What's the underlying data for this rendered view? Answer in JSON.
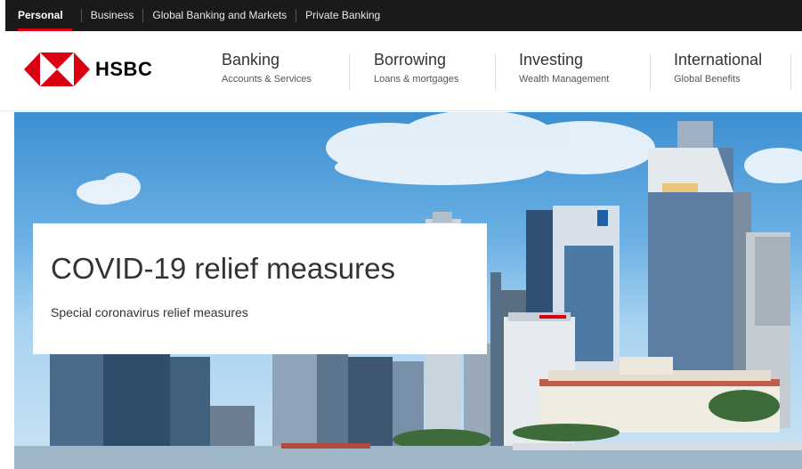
{
  "segments": [
    {
      "label": "Personal",
      "active": true
    },
    {
      "label": "Business",
      "active": false
    },
    {
      "label": "Global Banking and Markets",
      "active": false
    },
    {
      "label": "Private Banking",
      "active": false
    }
  ],
  "brand": {
    "name": "HSBC",
    "primary_color": "#db0011"
  },
  "nav": [
    {
      "title": "Banking",
      "sub": "Accounts & Services"
    },
    {
      "title": "Borrowing",
      "sub": "Loans & mortgages"
    },
    {
      "title": "Investing",
      "sub": "Wealth Management"
    },
    {
      "title": "International",
      "sub": "Global Benefits"
    }
  ],
  "hero": {
    "title": "COVID-19 relief measures",
    "subtitle": "Special coronavirus relief measures"
  },
  "icons": {
    "logo": "hsbc-hexagon-logo-icon"
  }
}
